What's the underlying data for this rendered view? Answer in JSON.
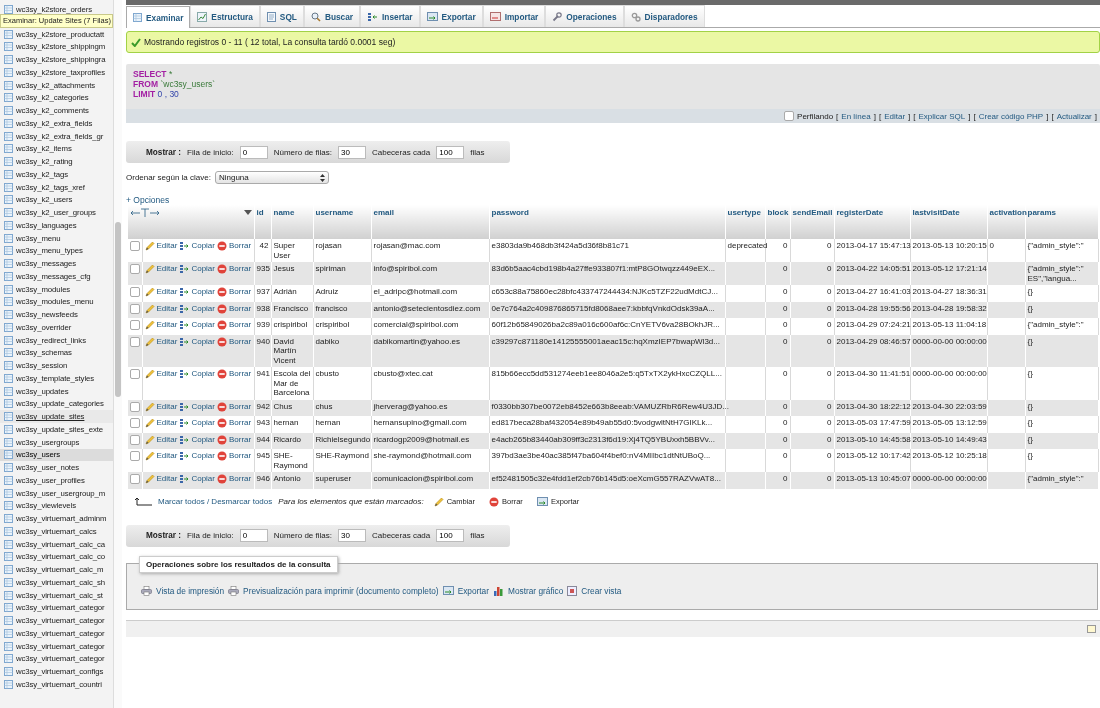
{
  "sidebar": {
    "tooltip": "Examinar: Update Sites (7 Filas)",
    "items": [
      {
        "label": "wc3sy_k2store_orders",
        "selected": false,
        "hovered": false
      },
      {
        "label": "wc3sy_k2store_productatt",
        "selected": false,
        "hovered": false
      },
      {
        "label": "wc3sy_k2store_shippingm",
        "selected": false,
        "hovered": false
      },
      {
        "label": "wc3sy_k2store_shippingra",
        "selected": false,
        "hovered": false
      },
      {
        "label": "wc3sy_k2store_taxprofiles",
        "selected": false,
        "hovered": false
      },
      {
        "label": "wc3sy_k2_attachments",
        "selected": false,
        "hovered": false
      },
      {
        "label": "wc3sy_k2_categories",
        "selected": false,
        "hovered": false
      },
      {
        "label": "wc3sy_k2_comments",
        "selected": false,
        "hovered": false
      },
      {
        "label": "wc3sy_k2_extra_fields",
        "selected": false,
        "hovered": false
      },
      {
        "label": "wc3sy_k2_extra_fields_gr",
        "selected": false,
        "hovered": false
      },
      {
        "label": "wc3sy_k2_items",
        "selected": false,
        "hovered": false
      },
      {
        "label": "wc3sy_k2_rating",
        "selected": false,
        "hovered": false
      },
      {
        "label": "wc3sy_k2_tags",
        "selected": false,
        "hovered": false
      },
      {
        "label": "wc3sy_k2_tags_xref",
        "selected": false,
        "hovered": false
      },
      {
        "label": "wc3sy_k2_users",
        "selected": false,
        "hovered": false
      },
      {
        "label": "wc3sy_k2_user_groups",
        "selected": false,
        "hovered": false
      },
      {
        "label": "wc3sy_languages",
        "selected": false,
        "hovered": false
      },
      {
        "label": "wc3sy_menu",
        "selected": false,
        "hovered": false
      },
      {
        "label": "wc3sy_menu_types",
        "selected": false,
        "hovered": false
      },
      {
        "label": "wc3sy_messages",
        "selected": false,
        "hovered": false
      },
      {
        "label": "wc3sy_messages_cfg",
        "selected": false,
        "hovered": false
      },
      {
        "label": "wc3sy_modules",
        "selected": false,
        "hovered": false
      },
      {
        "label": "wc3sy_modules_menu",
        "selected": false,
        "hovered": false
      },
      {
        "label": "wc3sy_newsfeeds",
        "selected": false,
        "hovered": false
      },
      {
        "label": "wc3sy_overrider",
        "selected": false,
        "hovered": false
      },
      {
        "label": "wc3sy_redirect_links",
        "selected": false,
        "hovered": false
      },
      {
        "label": "wc3sy_schemas",
        "selected": false,
        "hovered": false
      },
      {
        "label": "wc3sy_session",
        "selected": false,
        "hovered": false
      },
      {
        "label": "wc3sy_template_styles",
        "selected": false,
        "hovered": false
      },
      {
        "label": "wc3sy_updates",
        "selected": false,
        "hovered": false
      },
      {
        "label": "wc3sy_update_categories",
        "selected": false,
        "hovered": false
      },
      {
        "label": "wc3sy_update_sites",
        "selected": false,
        "hovered": true
      },
      {
        "label": "wc3sy_update_sites_exte",
        "selected": false,
        "hovered": false
      },
      {
        "label": "wc3sy_usergroups",
        "selected": false,
        "hovered": false
      },
      {
        "label": "wc3sy_users",
        "selected": true,
        "hovered": false
      },
      {
        "label": "wc3sy_user_notes",
        "selected": false,
        "hovered": false
      },
      {
        "label": "wc3sy_user_profiles",
        "selected": false,
        "hovered": false
      },
      {
        "label": "wc3sy_user_usergroup_m",
        "selected": false,
        "hovered": false
      },
      {
        "label": "wc3sy_viewlevels",
        "selected": false,
        "hovered": false
      },
      {
        "label": "wc3sy_virtuemart_adminm",
        "selected": false,
        "hovered": false
      },
      {
        "label": "wc3sy_virtuemart_calcs",
        "selected": false,
        "hovered": false
      },
      {
        "label": "wc3sy_virtuemart_calc_ca",
        "selected": false,
        "hovered": false
      },
      {
        "label": "wc3sy_virtuemart_calc_co",
        "selected": false,
        "hovered": false
      },
      {
        "label": "wc3sy_virtuemart_calc_m",
        "selected": false,
        "hovered": false
      },
      {
        "label": "wc3sy_virtuemart_calc_sh",
        "selected": false,
        "hovered": false
      },
      {
        "label": "wc3sy_virtuemart_calc_st",
        "selected": false,
        "hovered": false
      },
      {
        "label": "wc3sy_virtuemart_categor",
        "selected": false,
        "hovered": false
      },
      {
        "label": "wc3sy_virtuemart_categor",
        "selected": false,
        "hovered": false
      },
      {
        "label": "wc3sy_virtuemart_categor",
        "selected": false,
        "hovered": false
      },
      {
        "label": "wc3sy_virtuemart_categor",
        "selected": false,
        "hovered": false
      },
      {
        "label": "wc3sy_virtuemart_categor",
        "selected": false,
        "hovered": false
      },
      {
        "label": "wc3sy_virtuemart_configs",
        "selected": false,
        "hovered": false
      },
      {
        "label": "wc3sy_virtuemart_countri",
        "selected": false,
        "hovered": false
      }
    ]
  },
  "tabs": [
    {
      "label": "Examinar",
      "selected": true
    },
    {
      "label": "Estructura",
      "selected": false
    },
    {
      "label": "SQL",
      "selected": false
    },
    {
      "label": "Buscar",
      "selected": false
    },
    {
      "label": "Insertar",
      "selected": false
    },
    {
      "label": "Exportar",
      "selected": false
    },
    {
      "label": "Importar",
      "selected": false
    },
    {
      "label": "Operaciones",
      "selected": false
    },
    {
      "label": "Disparadores",
      "selected": false
    }
  ],
  "message": "Mostrando registros 0 - 11 ( 12 total, La consulta tardó 0.0001 seg)",
  "sql": {
    "lines": [
      {
        "keyword": "SELECT",
        "rest": "*"
      },
      {
        "keyword": "FROM",
        "rest": "`wc3sy_users`"
      },
      {
        "keyword": "LIMIT",
        "rest": "0 , 30"
      }
    ],
    "profiling": {
      "label": "Perfilando",
      "checked": false
    },
    "links": [
      {
        "before": "[",
        "label": "En línea",
        "after": "]"
      },
      {
        "before": "[",
        "label": "Editar",
        "after": "]"
      },
      {
        "before": "[",
        "label": "Explicar SQL",
        "after": "]"
      },
      {
        "before": "[",
        "label": "Crear código PHP",
        "after": "]"
      },
      {
        "before": "[",
        "label": "Actualizar",
        "after": "]"
      }
    ]
  },
  "navigation_top": {
    "label": "Mostrar :",
    "fields": [
      {
        "label": "Fila de inicio:",
        "value": "0"
      },
      {
        "label": "Número de filas:",
        "value": "30"
      },
      {
        "label": "Cabeceras cada",
        "value": "100"
      }
    ],
    "suffix": "filas"
  },
  "sort": {
    "label": "Ordenar según la clave:",
    "value": "Ninguna"
  },
  "options_link": "+ Opciones",
  "table": {
    "columns": [
      "id",
      "name",
      "username",
      "email",
      "password",
      "usertype",
      "block",
      "sendEmail",
      "registerDate",
      "lastvisitDate",
      "activation",
      "params"
    ],
    "rows": [
      {
        "checked": false,
        "actions": [
          "Editar",
          "Copiar",
          "Borrar"
        ],
        "cells": [
          "42",
          "Super User",
          "rojasan",
          "rojasan@mac.com",
          "e3803da9b468db3f424a5d36f8b81c71",
          "deprecated",
          "0",
          "0",
          "2013-04-17 15:47:13",
          "2013-05-13 10:20:15",
          "0",
          "{\"admin_style\":\""
        ]
      },
      {
        "checked": false,
        "actions": [
          "Editar",
          "Copiar",
          "Borrar"
        ],
        "cells": [
          "935",
          "Jesus",
          "spiriman",
          "info@spiribol.com",
          "83d6b5aac4cbd198b4a27ffe933807f1:mtP8GOtwqzz449eEX...",
          null,
          "0",
          "0",
          "2013-04-22 14:05:51",
          "2013-05-12 17:21:14",
          null,
          "{\"admin_style\":\"\nES\",\"langua..."
        ]
      },
      {
        "checked": false,
        "actions": [
          "Editar",
          "Copiar",
          "Borrar"
        ],
        "cells": [
          "937",
          "Adrián",
          "Adruiz",
          "el_adripc@hotmail.com",
          "c653c88a75860ec28bfc433747244434:NJKc5TZF22udMdtCJ...",
          null,
          "0",
          "0",
          "2013-04-27 16:41:03",
          "2013-04-27 18:36:31",
          null,
          "{}"
        ]
      },
      {
        "checked": false,
        "actions": [
          "Editar",
          "Copiar",
          "Borrar"
        ],
        "cells": [
          "938",
          "Francisco",
          "francisco",
          "antonio@setecientosdiez.com",
          "0e7c764a2c409876865715fd8068aee7:kbbfqVnkdOdsk39aA...",
          null,
          "0",
          "0",
          "2013-04-28 19:55:56",
          "2013-04-28 19:58:32",
          null,
          "{}"
        ]
      },
      {
        "checked": false,
        "actions": [
          "Editar",
          "Copiar",
          "Borrar"
        ],
        "cells": [
          "939",
          "crispiribol",
          "crispiribol",
          "comercial@spiribol.com",
          "60f12b65849026ba2c89a016c600af6c:CnYETV6va28BOkhJR...",
          null,
          "0",
          "0",
          "2013-04-29 07:24:21",
          "2013-05-13 11:04:18",
          null,
          "{\"admin_style\":\""
        ]
      },
      {
        "checked": false,
        "actions": [
          "Editar",
          "Copiar",
          "Borrar"
        ],
        "cells": [
          "940",
          "David Martín Vicent",
          "dabiko",
          "dabikomartin@yahoo.es",
          "c39297c871180e14125555001aeac15c:hqXmzIEP7bwapWl3d...",
          null,
          "0",
          "0",
          "2013-04-29 08:46:57",
          "0000-00-00 00:00:00",
          null,
          "{}"
        ]
      },
      {
        "checked": false,
        "actions": [
          "Editar",
          "Copiar",
          "Borrar"
        ],
        "cells": [
          "941",
          "Escola del Mar de Barcelona",
          "cbusto",
          "cbusto@xtec.cat",
          "815b66ecc5dd531274eeb1ee8046a2e5:q5TxTX2ykHxcCZQLL...",
          null,
          "0",
          "0",
          "2013-04-30 11:41:51",
          "0000-00-00 00:00:00",
          null,
          "{}"
        ]
      },
      {
        "checked": false,
        "actions": [
          "Editar",
          "Copiar",
          "Borrar"
        ],
        "cells": [
          "942",
          "Chus",
          "chus",
          "jherverag@yahoo.es",
          "f0330bb307be0072eb8452e663b8eeab:VAMUZRbR6Rew4U3JD...",
          null,
          "0",
          "0",
          "2013-04-30 18:22:12",
          "2013-04-30 22:03:59",
          null,
          "{}"
        ]
      },
      {
        "checked": false,
        "actions": [
          "Editar",
          "Copiar",
          "Borrar"
        ],
        "cells": [
          "943",
          "hernan",
          "hernan",
          "hernansupino@gmail.com",
          "ed817beca28baf432054e89b49ab55d0:5vodgwltNtH7GIKLk...",
          null,
          "0",
          "0",
          "2013-05-03 17:47:59",
          "2013-05-05 13:12:59",
          null,
          "{}"
        ]
      },
      {
        "checked": false,
        "actions": [
          "Editar",
          "Copiar",
          "Borrar"
        ],
        "cells": [
          "944",
          "Ricardo",
          "Richielsegundo",
          "ricardogp2009@hotmail.es",
          "e4acb265b83440ab309ff3c2313f6d19:Xj4TQ5YBUxxh5BBVv...",
          null,
          "0",
          "0",
          "2013-05-10 14:45:58",
          "2013-05-10 14:49:43",
          null,
          "{}"
        ]
      },
      {
        "checked": false,
        "actions": [
          "Editar",
          "Copiar",
          "Borrar"
        ],
        "cells": [
          "945",
          "SHE-Raymond",
          "SHE-Raymond",
          "she-raymond@hotmail.com",
          "397bd3ae3be40ac385f47ba604f4bef0:nV4MIIbc1dtNtUBoQ...",
          null,
          "0",
          "0",
          "2013-05-12 10:17:42",
          "2013-05-12 10:25:18",
          null,
          "{}"
        ]
      },
      {
        "checked": false,
        "actions": [
          "Editar",
          "Copiar",
          "Borrar"
        ],
        "cells": [
          "946",
          "Antonio",
          "superuser",
          "comunicacion@spiribol.com",
          "ef52481505c32e4fdd1ef2cb76b145d5:oeXcmG557RAZVwAT8...",
          null,
          "0",
          "0",
          "2013-05-13 10:45:07",
          "0000-00-00 00:00:00",
          null,
          "{\"admin_style\":\""
        ]
      }
    ]
  },
  "bulk": {
    "toggle": "Marcar todos / Desmarcar todos",
    "note": "Para los elementos que están marcados:",
    "actions": [
      "Cambiar",
      "Borrar",
      "Exportar"
    ]
  },
  "navigation_bottom": {
    "label": "Mostrar :",
    "fields": [
      {
        "label": "Fila de inicio:",
        "value": "0"
      },
      {
        "label": "Número de filas:",
        "value": "30"
      },
      {
        "label": "Cabeceras cada",
        "value": "100"
      }
    ],
    "suffix": "filas"
  },
  "operations": {
    "legend": "Operaciones sobre los resultados de la consulta",
    "links": [
      "Vista de impresión",
      "Previsualización para imprimir (documento completo)",
      "Exportar",
      "Mostrar gráfico",
      "Crear vista"
    ]
  }
}
